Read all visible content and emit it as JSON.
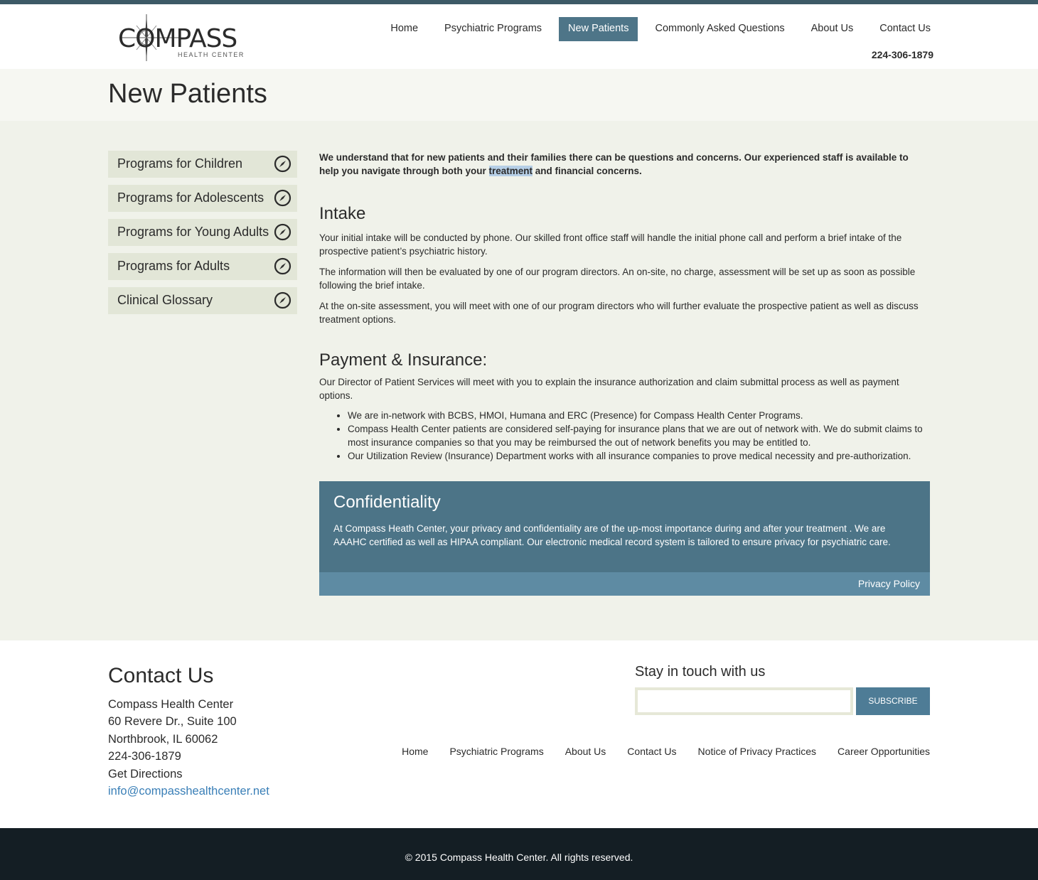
{
  "header": {
    "logo_text": "COMPASS",
    "logo_subtext": "HEALTH CENTER",
    "nav": [
      {
        "label": "Home"
      },
      {
        "label": "Psychiatric Programs"
      },
      {
        "label": "New Patients",
        "active": true
      },
      {
        "label": "Commonly Asked Questions"
      },
      {
        "label": "About Us"
      },
      {
        "label": "Contact Us"
      }
    ],
    "phone": "224-306-1879"
  },
  "page": {
    "title": "New Patients"
  },
  "sidebar": {
    "items": [
      {
        "label": "Programs for Children",
        "icon": "compass-icon"
      },
      {
        "label": "Programs for Adolescents",
        "icon": "compass-icon"
      },
      {
        "label": "Programs for Young Adults",
        "icon": "compass-icon"
      },
      {
        "label": "Programs for Adults",
        "icon": "compass-icon"
      },
      {
        "label": "Clinical Glossary",
        "icon": "compass-icon"
      }
    ]
  },
  "content": {
    "intro_before": "We understand that for new patients and their families there can be questions and concerns.   Our experienced staff is available to help you navigate through both your ",
    "intro_highlight": "treatment",
    "intro_after": " and financial concerns.",
    "intake": {
      "heading": "Intake",
      "paragraphs": [
        "Your initial intake will be conducted by phone. Our skilled front office staff will handle the initial phone call and perform a brief intake of the prospective patient’s psychiatric history.",
        "The information will then be evaluated by one of our program directors.  An on-site, no charge, assessment will be set up as soon as possible following the brief intake.",
        "At the on-site assessment, you will meet with one of our program directors who will further evaluate the prospective patient as well as discuss treatment options."
      ]
    },
    "payment": {
      "heading": "Payment & Insurance:",
      "paragraph": "Our Director of Patient Services will meet with you to explain the insurance authorization and claim submittal process as well as payment options.",
      "bullets": [
        "We are in-network with  BCBS, HMOI, Humana and ERC (Presence)  for Compass Health Center Programs.",
        "Compass Health Center patients are considered self-paying for insurance plans that we are out of network with. We do submit claims to most insurance companies so that you may be reimbursed the out of network benefits you may be entitled to.",
        "Our Utilization Review (Insurance) Department works with all insurance companies to prove medical necessity and pre-authorization."
      ]
    },
    "confidentiality": {
      "heading": "Confidentiality",
      "text": "At Compass Heath Center, your privacy and confidentiality are of the up-most importance during and after your treatment . We are AAAHC certified as well as HIPAA compliant. Our electronic medical record system is tailored to ensure privacy for psychiatric care.",
      "link": "Privacy Policy"
    }
  },
  "footer": {
    "title": "Contact Us",
    "address": [
      "Compass Health Center",
      "60 Revere Dr., Suite 100",
      "Northbrook, IL 60062",
      "224-306-1879"
    ],
    "directions": "Get Directions",
    "email": "info@compasshealthcenter.net",
    "stay_title": "Stay in touch with us",
    "subscribe_label": "SUBSCRIBE",
    "subscribe_value": "",
    "nav": [
      {
        "label": "Home"
      },
      {
        "label": "Psychiatric Programs"
      },
      {
        "label": "About Us"
      },
      {
        "label": "Contact Us"
      },
      {
        "label": "Notice of Privacy Practices"
      },
      {
        "label": "Career Opportunities"
      }
    ],
    "copyright": "© 2015 Compass Health Center. All rights reserved."
  },
  "colors": {
    "top_bar": "#3d5a66",
    "nav_active": "#4e7588",
    "main_bg": "#f0f2ea",
    "sidebar_item_bg": "#e2e6d7",
    "confidentiality_bg": "#4c7487",
    "confidentiality_bar": "#5e8ba3",
    "link": "#3a7fb7",
    "footer_bottom": "#141e24"
  }
}
